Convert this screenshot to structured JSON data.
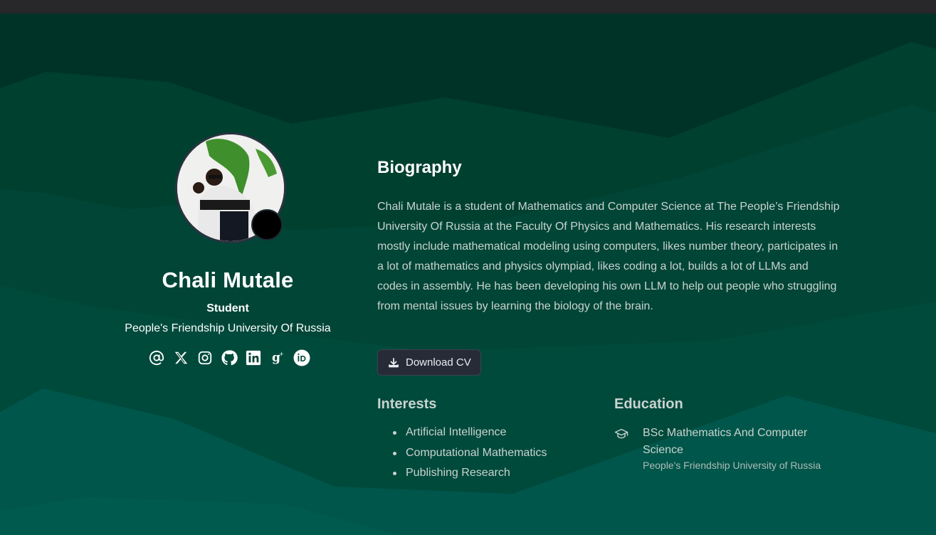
{
  "profile": {
    "name": "Chali Mutale",
    "role": "Student",
    "organization": "People's Friendship University Of Russia"
  },
  "socials": [
    {
      "icon": "at-icon"
    },
    {
      "icon": "x-twitter-icon"
    },
    {
      "icon": "instagram-icon"
    },
    {
      "icon": "github-icon"
    },
    {
      "icon": "linkedin-icon"
    },
    {
      "icon": "google-scholar-icon"
    },
    {
      "icon": "orcid-icon"
    }
  ],
  "biography": {
    "title": "Biography",
    "text": "Chali Mutale is a student of Mathematics and Computer Science at The People’s Friendship University Of Russia at the Faculty Of Physics and Mathematics. His research interests mostly include mathematical modeling using computers, likes number theory, participates in a lot of mathematics and physics olympiad, likes coding a lot, builds a lot of LLMs and codes in assembly. He has been developing his own LLM to help out people who struggling from mental issues by learning the biology of the brain.",
    "download_label": "Download CV",
    "download_icon": "download-icon"
  },
  "interests": {
    "title": "Interests",
    "items": [
      "Artificial Intelligence",
      "Computational Mathematics",
      "Publishing Research"
    ]
  },
  "education": {
    "title": "Education",
    "icon": "graduation-cap-icon",
    "degree": "BSc Mathematics And Computer Science",
    "school": "People's Friendship University of Russia"
  },
  "colors": {
    "background_dark": "#003327",
    "background_mid": "#00493b",
    "background_light": "#00564a",
    "topbar": "#28282b",
    "button_bg": "#272b38"
  }
}
